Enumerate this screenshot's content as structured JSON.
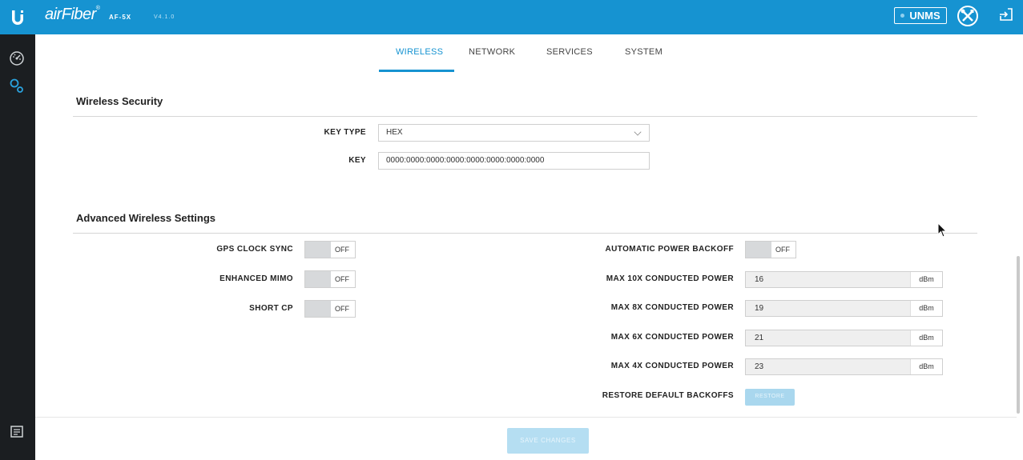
{
  "topbar": {
    "brand": "airFiber",
    "brand_mark": "®",
    "model": "AF-5X",
    "version": "V4.1.0",
    "unms_label": "UNMS"
  },
  "tabs": [
    {
      "label": "WIRELESS",
      "active": true
    },
    {
      "label": "NETWORK",
      "active": false
    },
    {
      "label": "SERVICES",
      "active": false
    },
    {
      "label": "SYSTEM",
      "active": false
    }
  ],
  "wireless_security": {
    "title": "Wireless Security",
    "key_type_label": "KEY TYPE",
    "key_type_value": "HEX",
    "key_label": "KEY",
    "key_value": "0000:0000:0000:0000:0000:0000:0000:0000"
  },
  "advanced": {
    "title": "Advanced Wireless Settings",
    "gps_clock_sync": {
      "label": "GPS CLOCK SYNC",
      "state": "OFF"
    },
    "enhanced_mimo": {
      "label": "ENHANCED MIMO",
      "state": "OFF"
    },
    "short_cp": {
      "label": "SHORT CP",
      "state": "OFF"
    },
    "auto_power_backoff": {
      "label": "AUTOMATIC POWER BACKOFF",
      "state": "OFF"
    },
    "powers": [
      {
        "label": "MAX 10X CONDUCTED POWER",
        "value": "16",
        "unit": "dBm"
      },
      {
        "label": "MAX 8X CONDUCTED POWER",
        "value": "19",
        "unit": "dBm"
      },
      {
        "label": "MAX 6X CONDUCTED POWER",
        "value": "21",
        "unit": "dBm"
      },
      {
        "label": "MAX 4X CONDUCTED POWER",
        "value": "23",
        "unit": "dBm"
      }
    ],
    "restore_label": "RESTORE DEFAULT BACKOFFS",
    "restore_button": "RESTORE"
  },
  "footer": {
    "save_button": "SAVE CHANGES"
  },
  "colors": {
    "accent": "#1693d1",
    "sidebar": "#1b1e21"
  }
}
